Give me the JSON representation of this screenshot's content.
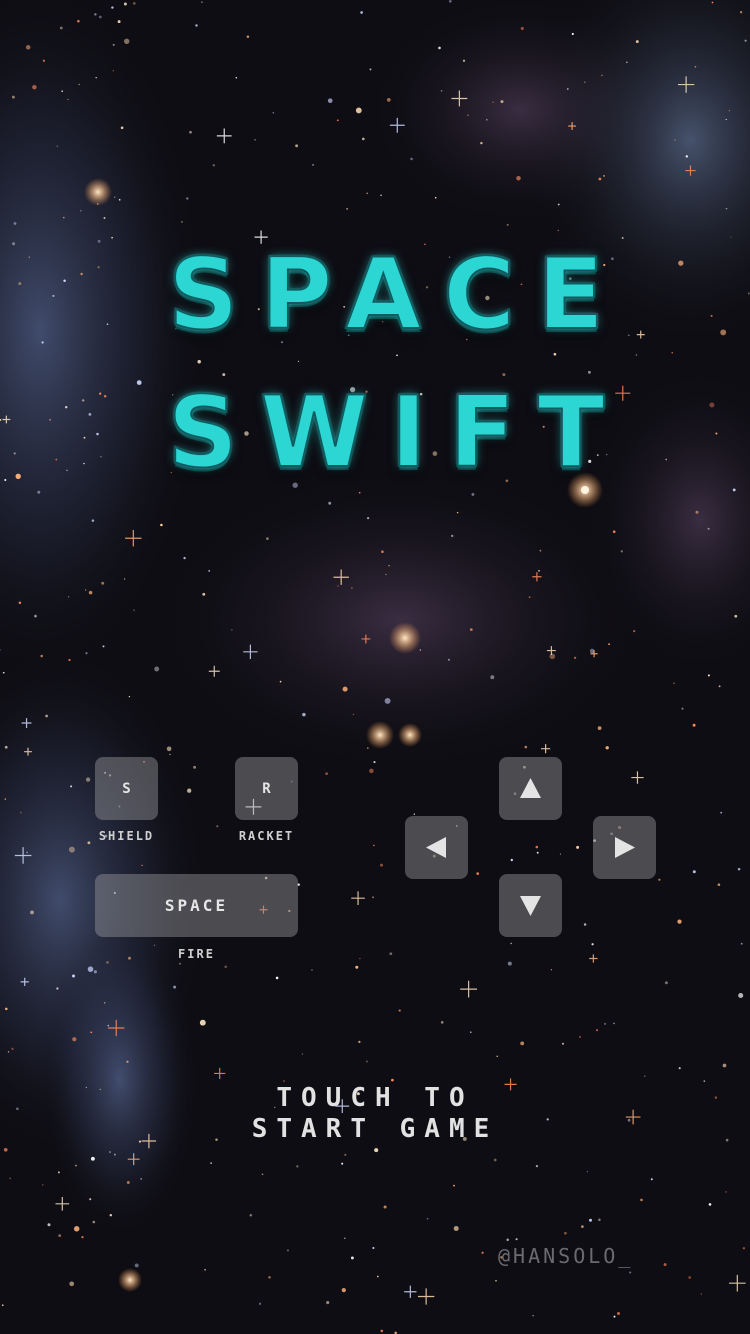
{
  "game": {
    "title_line1": "SPACE",
    "title_line2": "SWIFT",
    "accent_color": "#2bd6d3"
  },
  "controls": {
    "shield": {
      "key": "S",
      "label": "SHIELD"
    },
    "racket": {
      "key": "R",
      "label": "RACKET"
    },
    "fire": {
      "key": "SPACE",
      "label": "FIRE"
    },
    "arrows": [
      "arrow-up-icon",
      "arrow-left-icon",
      "arrow-right-icon",
      "arrow-down-icon"
    ]
  },
  "start_prompt": {
    "line1": "TOUCH TO",
    "line2": "START GAME"
  },
  "credit": "@HANSOLO_"
}
